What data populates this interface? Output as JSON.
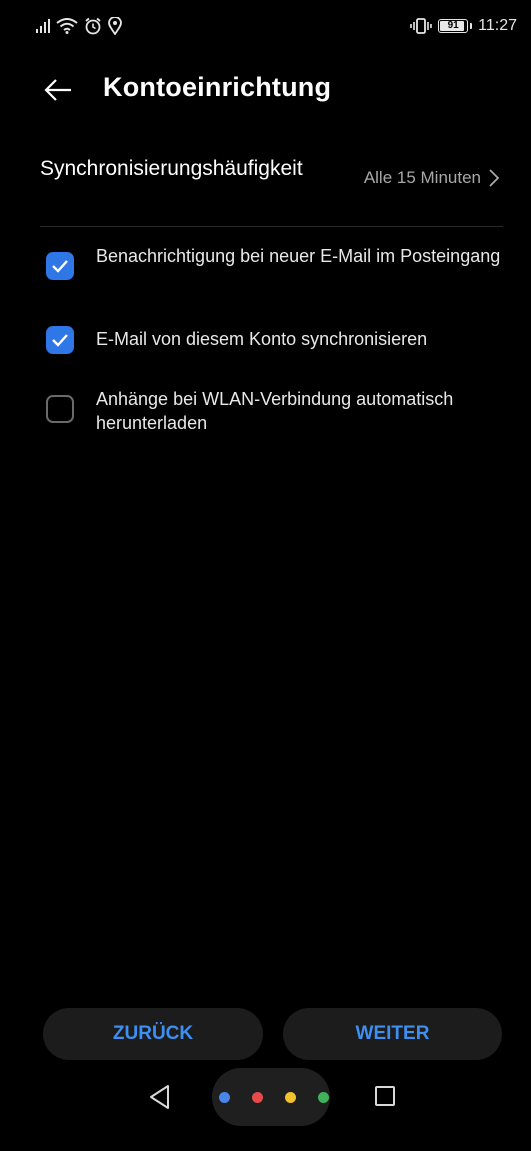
{
  "status_bar": {
    "time": "11:27",
    "battery": "91",
    "battery_level": 0.91,
    "icons": [
      "signal-icon",
      "wifi-icon",
      "alarm-icon",
      "location-icon",
      "vibrate-icon",
      "battery-icon"
    ]
  },
  "header": {
    "title": "Kontoeinrichtung",
    "back_icon": "arrow-left-icon"
  },
  "sync": {
    "label": "Synchronisierungshäufigkeit",
    "value": "Alle 15 Minuten",
    "chevron_icon": "chevron-right-icon"
  },
  "options": [
    {
      "label": "Benachrichtigung bei neuer E-Mail im Posteingang",
      "checked": true
    },
    {
      "label": "E-Mail von diesem Konto synchronisieren",
      "checked": true
    },
    {
      "label": "Anhänge bei WLAN-Verbindung automatisch herunterladen",
      "checked": false
    }
  ],
  "buttons": {
    "back_label": "ZURÜCK",
    "next_label": "WEITER"
  },
  "nav": {
    "dot_colors": [
      "#4a86e8",
      "#e84a4a",
      "#f2c12e",
      "#3fb25a"
    ]
  },
  "colors": {
    "accent": "#3d8ff2",
    "checkbox": "#2f76e6",
    "background": "#000000"
  }
}
